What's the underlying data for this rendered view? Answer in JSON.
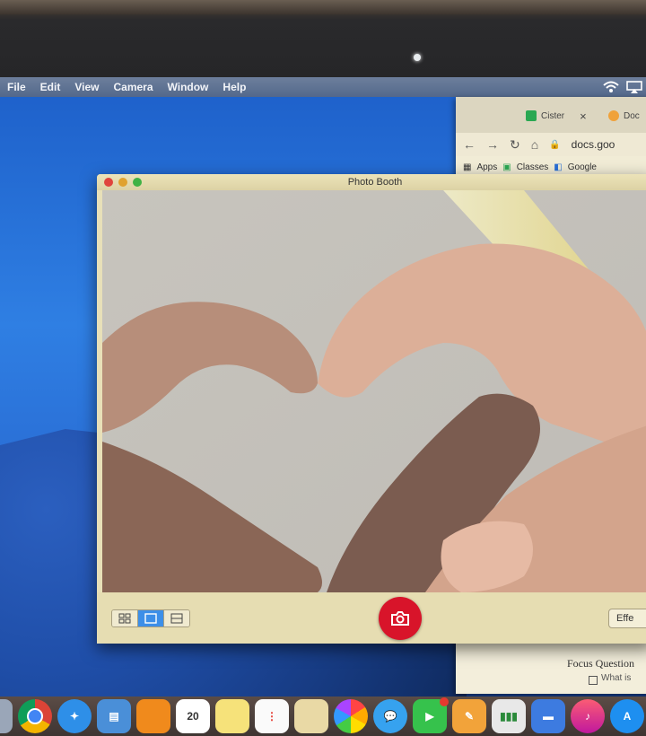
{
  "menubar": {
    "items": [
      "File",
      "Edit",
      "View",
      "Camera",
      "Window",
      "Help"
    ]
  },
  "browser": {
    "tab1": "Cister",
    "tab2": "Doc",
    "url": "docs.goo",
    "bookmarks": [
      "Apps",
      "Classes",
      "Google"
    ]
  },
  "doc": {
    "heading": "Focus Question",
    "item": "What is"
  },
  "photobooth": {
    "title": "Photo Booth",
    "effects_label": "Effe"
  },
  "dock": {
    "calendar_day": "20",
    "icons": [
      "finder-icon",
      "chrome-icon",
      "safari-icon",
      "preview-icon",
      "ibooks-icon",
      "calendar-icon",
      "notes-icon",
      "reminders-icon",
      "photo-viewer-icon",
      "photos-icon",
      "messages-icon",
      "facetime-icon",
      "pages-icon",
      "numbers-icon",
      "keynote-icon",
      "music-icon",
      "app-store-icon"
    ]
  },
  "colors": {
    "shutter": "#d8142a",
    "menubar": "#5e7294",
    "desktop_blue": "#2f7fe3"
  }
}
